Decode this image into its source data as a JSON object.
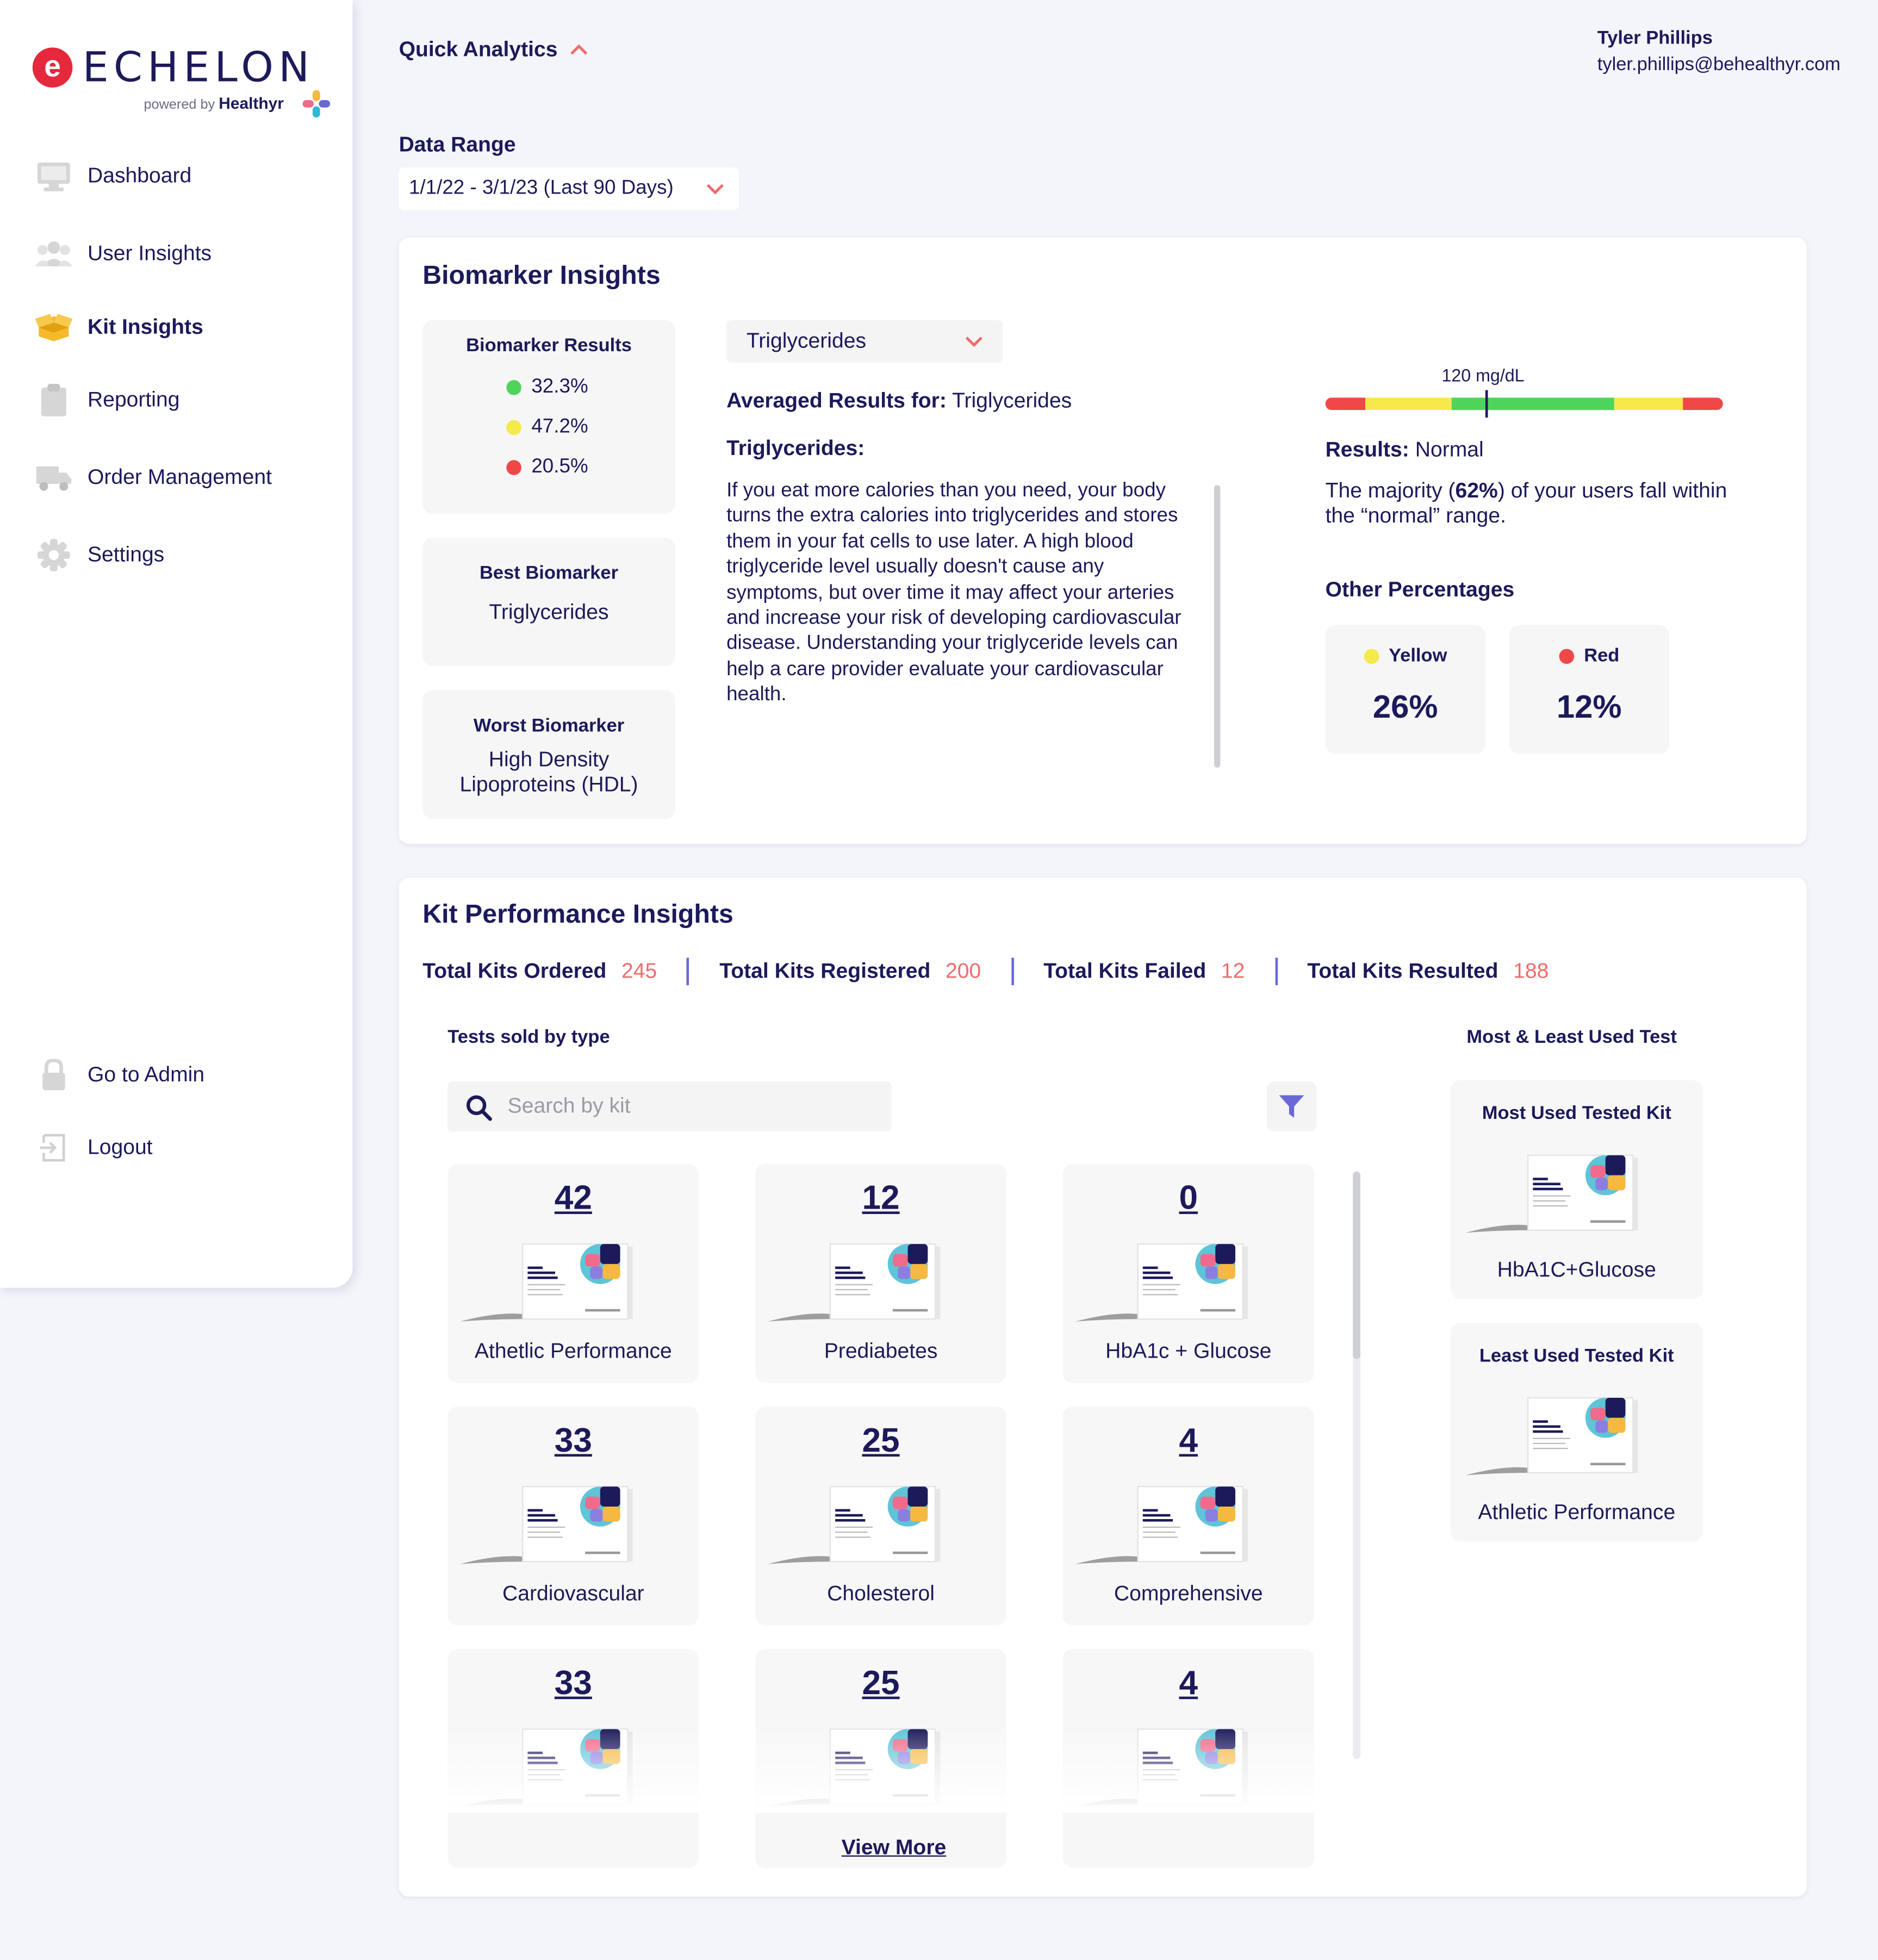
{
  "brand": {
    "name": "ECHELON",
    "mark": "e",
    "powered_by": "powered by",
    "partner": "Healthyr"
  },
  "colors": {
    "navy": "#1c1a5a",
    "green": "#4fd45b",
    "yellow": "#f5e94b",
    "red": "#f04848",
    "accent": "#f06b6b",
    "filter": "#6a68d8"
  },
  "sidebar": {
    "items": [
      {
        "label": "Dashboard",
        "icon": "monitor-icon"
      },
      {
        "label": "User Insights",
        "icon": "users-icon"
      },
      {
        "label": "Kit Insights",
        "icon": "box-icon",
        "active": true
      },
      {
        "label": "Reporting",
        "icon": "clipboard-icon"
      },
      {
        "label": "Order Management",
        "icon": "truck-icon"
      },
      {
        "label": "Settings",
        "icon": "gear-icon"
      }
    ],
    "bottom": [
      {
        "label": "Go to Admin",
        "icon": "lock-icon"
      },
      {
        "label": "Logout",
        "icon": "logout-icon"
      }
    ]
  },
  "header": {
    "quick_analytics": "Quick Analytics",
    "user_name": "Tyler Phillips",
    "user_email": "tyler.phillips@behealthyr.com"
  },
  "range": {
    "label": "Data Range",
    "value": "1/1/22 - 3/1/23 (Last 90 Days)"
  },
  "biomarker": {
    "title": "Biomarker Insights",
    "results_title": "Biomarker Results",
    "results": [
      {
        "value": "32.3%",
        "color": "green"
      },
      {
        "value": "47.2%",
        "color": "yellow"
      },
      {
        "value": "20.5%",
        "color": "red"
      }
    ],
    "best_title": "Best Biomarker",
    "best_value": "Triglycerides",
    "worst_title": "Worst Biomarker",
    "worst_value": "High Density Lipoproteins (HDL)",
    "selected": "Triglycerides",
    "avg_label": "Averaged Results for:",
    "avg_value": "Triglycerides",
    "desc_title": "Triglycerides:",
    "description": "If you eat more calories than you need, your body turns the extra calories into triglycerides and stores them in your fat cells to use later. A high blood triglyceride level usually doesn't cause any symptoms, but over time it may affect your arteries and increase your risk of developing cardiovascular disease. Understanding your triglyceride levels can help a care provider evaluate your cardiovascular health.",
    "gauge_label": "120 mg/dL",
    "results_label": "Results:",
    "results_value": "Normal",
    "majority_pre": "The majority (",
    "majority_pct": "62%",
    "majority_post": ") of your users fall within the “normal” range.",
    "other_title": "Other Percentages",
    "other": [
      {
        "label": "Yellow",
        "value": "26%"
      },
      {
        "label": "Red",
        "value": "12%"
      }
    ]
  },
  "kits": {
    "title": "Kit Performance Insights",
    "stats": [
      {
        "label": "Total Kits Ordered",
        "value": "245"
      },
      {
        "label": "Total Kits Registered",
        "value": "200"
      },
      {
        "label": "Total Kits Failed",
        "value": "12"
      },
      {
        "label": "Total Kits Resulted",
        "value": "188"
      }
    ],
    "tests_by_type": "Tests sold by type",
    "search_placeholder": "Search by kit",
    "most_least_title": "Most & Least Used Test",
    "tiles": [
      {
        "count": "42",
        "name": "Athetlic Performance"
      },
      {
        "count": "12",
        "name": "Prediabetes"
      },
      {
        "count": "0",
        "name": "HbA1c + Glucose"
      },
      {
        "count": "33",
        "name": "Cardiovascular"
      },
      {
        "count": "25",
        "name": "Cholesterol"
      },
      {
        "count": "4",
        "name": "Comprehensive"
      },
      {
        "count": "33",
        "name": ""
      },
      {
        "count": "25",
        "name": ""
      },
      {
        "count": "4",
        "name": ""
      }
    ],
    "most_used_title": "Most Used Tested Kit",
    "most_used_name": "HbA1C+Glucose",
    "least_used_title": "Least Used Tested Kit",
    "least_used_name": "Athletic Performance",
    "view_more": "View More"
  }
}
